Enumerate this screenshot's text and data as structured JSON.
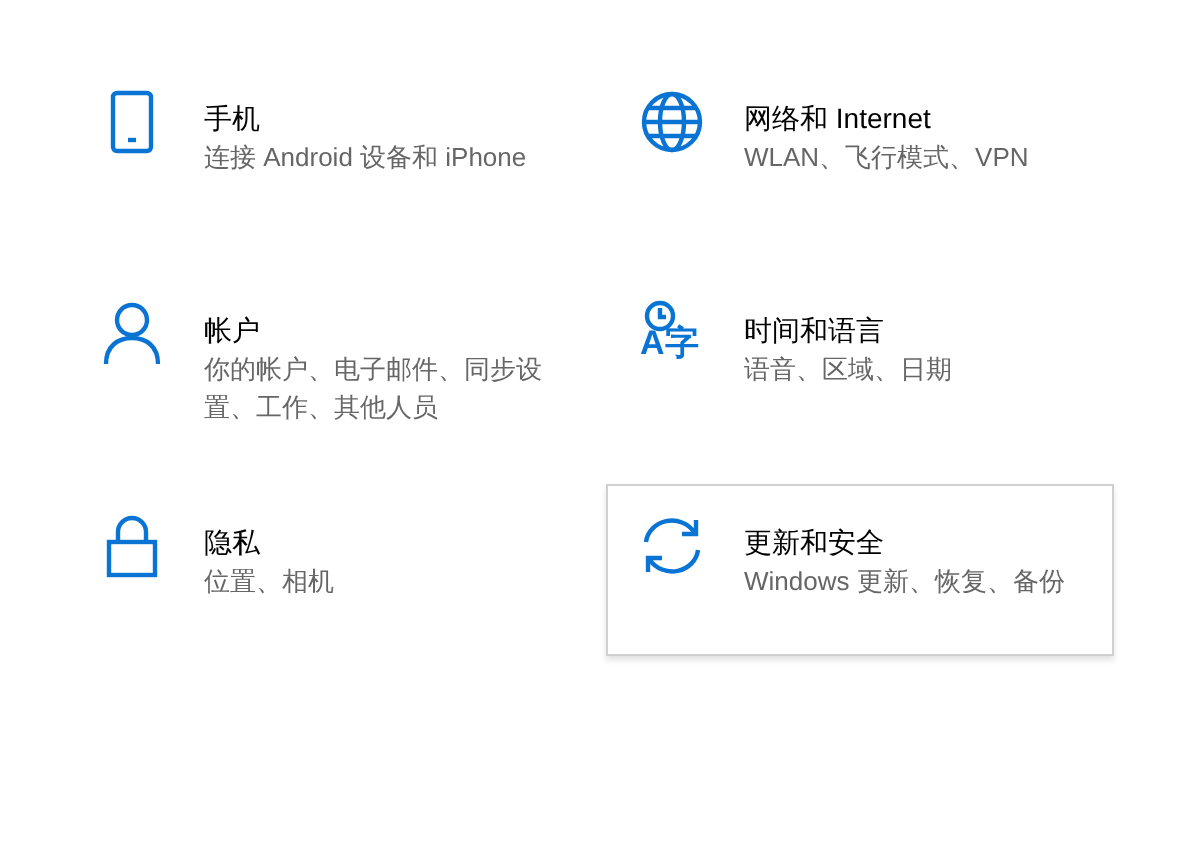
{
  "settings_tiles": [
    {
      "kind": "phone",
      "title": "手机",
      "subtitle": "连接 Android 设备和 iPhone",
      "hovered": false
    },
    {
      "kind": "globe",
      "title": "网络和 Internet",
      "subtitle": "WLAN、飞行模式、VPN",
      "hovered": false
    },
    {
      "kind": "person",
      "title": "帐户",
      "subtitle": "你的帐户、电子邮件、同步设置、工作、其他人员",
      "hovered": false
    },
    {
      "kind": "time-language",
      "title": "时间和语言",
      "subtitle": "语音、区域、日期",
      "hovered": false,
      "icon_text": "A字"
    },
    {
      "kind": "lock",
      "title": "隐私",
      "subtitle": "位置、相机",
      "hovered": false
    },
    {
      "kind": "sync",
      "title": "更新和安全",
      "subtitle": "Windows 更新、恢复、备份",
      "hovered": true
    }
  ]
}
